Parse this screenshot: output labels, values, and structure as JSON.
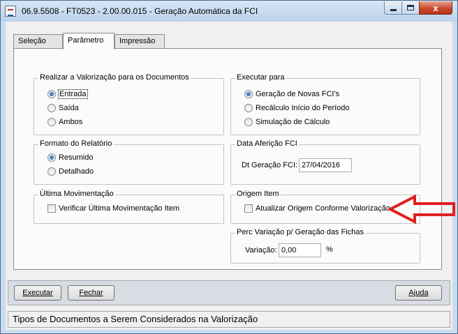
{
  "window": {
    "title": "06.9.5508 - FT0523 - 2.00.00.015 - Geração Automática da FCI",
    "close_glyph": "x",
    "icons": {
      "app": "app-icon",
      "minimize": "minimize-icon",
      "maximize": "maximize-icon",
      "close": "close-icon"
    }
  },
  "tabs": [
    {
      "label": "Seleção",
      "active": false
    },
    {
      "label": "Parâmetro",
      "active": true
    },
    {
      "label": "Impressão",
      "active": false
    }
  ],
  "valorizacao": {
    "title": "Realizar a Valorização para os Documentos",
    "options": [
      "Entrada",
      "Saída",
      "Ambos"
    ],
    "selected": "Entrada"
  },
  "executar": {
    "title": "Executar para",
    "options": [
      "Geração de Novas FCI's",
      "Recálculo Início do Período",
      "Simulação de Cálculo"
    ],
    "selected": "Geração de Novas FCI's"
  },
  "formato": {
    "title": "Formato do Relatório",
    "options": [
      "Resumido",
      "Detalhado"
    ],
    "selected": "Resumido"
  },
  "afericao": {
    "title": "Data Aferição FCI",
    "field_label": "Dt Geração FCI:",
    "value": "27/04/2016"
  },
  "movimentacao": {
    "title": "Última Movimentação",
    "checkbox_label": "Verificar Última Movimentação Item",
    "checked": false
  },
  "origem": {
    "title": "Origem Item",
    "checkbox_label": "Atualizar Origem Conforme Valorização",
    "checked": false
  },
  "variacao": {
    "title": "Perc Variação p/ Geração das Fichas",
    "field_label": "Variação:",
    "value": "0,00",
    "unit": "%"
  },
  "buttons": {
    "executar": "Executar",
    "fechar": "Fechar",
    "ajuda": "Ajuda"
  },
  "status_text": "Tipos de Documentos a Serem Considerados na Valorização",
  "annotation_arrow": {
    "color": "#e02020",
    "icon": "red-arrow-icon"
  }
}
